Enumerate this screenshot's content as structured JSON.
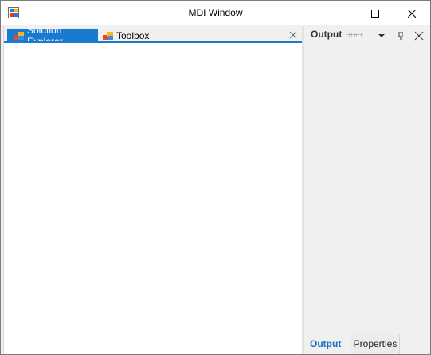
{
  "window": {
    "title": "MDI Window",
    "icon": "app-window-icon",
    "controls": [
      "minimize-icon",
      "maximize-icon",
      "close-icon"
    ]
  },
  "document_tabs": {
    "active": "Solution Explorer",
    "items": [
      {
        "label": "Solution Explorer",
        "icon": "solution-explorer-icon",
        "active": true
      },
      {
        "label": "Toolbox",
        "icon": "toolbox-icon",
        "active": false
      }
    ],
    "close_icon": "close-icon"
  },
  "tool_panel": {
    "title": "Output",
    "header_buttons": [
      "dropdown-arrow-icon",
      "pin-icon",
      "close-icon"
    ],
    "bottom_tabs": [
      {
        "label": "Output",
        "active": true
      },
      {
        "label": "Properties",
        "active": false
      }
    ]
  },
  "colors": {
    "accent": "#1a7ad0",
    "active_tab_text": "#1a6fc4",
    "panel_bg": "#f0f0f0"
  }
}
